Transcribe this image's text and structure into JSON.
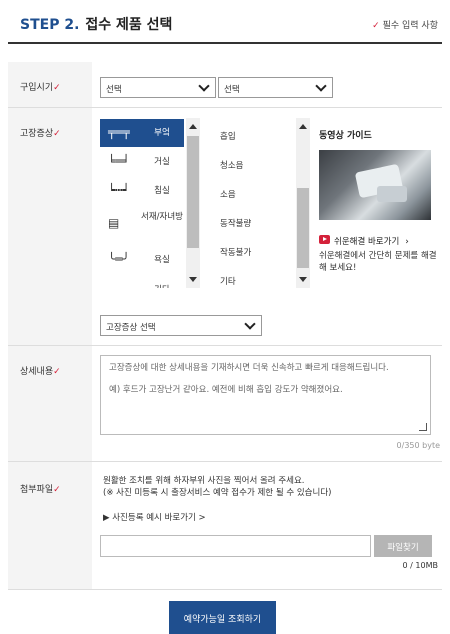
{
  "header": {
    "step_label": "STEP 2.",
    "title": "접수 제품 선택",
    "required_check": "✓",
    "required_note": "필수 입력 사항"
  },
  "purchase": {
    "label": "구입시기",
    "check": "✓",
    "select1": "선택",
    "select2": "선택"
  },
  "symptom": {
    "label": "고장증상",
    "check": "✓",
    "products": [
      {
        "icon": "range-hood-icon",
        "glyph": "╤═╤",
        "label": "부엌",
        "active": true
      },
      {
        "icon": "sofa-icon",
        "glyph": "╘═╛",
        "label": "거실",
        "active": false
      },
      {
        "icon": "bed-icon",
        "glyph": "┕┅┙",
        "label": "침실",
        "active": false
      },
      {
        "icon": "cabinet-icon",
        "glyph": "▤",
        "label": "서재/자녀방",
        "active": false
      },
      {
        "icon": "bathtub-icon",
        "glyph": "╰═╯",
        "label": "욕실",
        "active": false
      },
      {
        "icon": "misc-icon",
        "glyph": "┌─┐",
        "label": "기타",
        "active": false
      }
    ],
    "symptoms": [
      "흡입",
      "청소음",
      "소음",
      "동작불량",
      "작동불가",
      "기타"
    ],
    "select_placeholder": "고장증상 선택",
    "guide": {
      "title": "동영상 가이드",
      "link_label": "쉬운해결 바로가기",
      "link_arrow": "›",
      "description": "쉬운해결에서 간단히 문제를 해결해 보세요!"
    }
  },
  "detail": {
    "label": "상세내용",
    "check": "✓",
    "placeholder_line1": "고장증상에 대한 상세내용을 기재하시면 더욱 신속하고 빠르게 대응해드립니다.",
    "placeholder_line2": "예) 후드가 고장난거 같아요. 예전에 비해 흡입 강도가 약해졌어요.",
    "byte_count": "0/350 byte"
  },
  "attach": {
    "label": "첨부파일",
    "check": "✓",
    "line1": "원활한 조치를 위해 하자부위 사진을 찍어서 올려 주세요.",
    "line2": "(※ 사진 미등록 시 출장서비스 예약 접수가 제한 될 수 있습니다)",
    "example_link": "▶ 사진등록 예시 바로가기 >",
    "button": "파일찾기",
    "size": "0 / 10MB"
  },
  "submit": {
    "label": "예약가능일 조회하기"
  },
  "colors": {
    "primary": "#1f4f8f",
    "required_check": "#d4213a"
  }
}
